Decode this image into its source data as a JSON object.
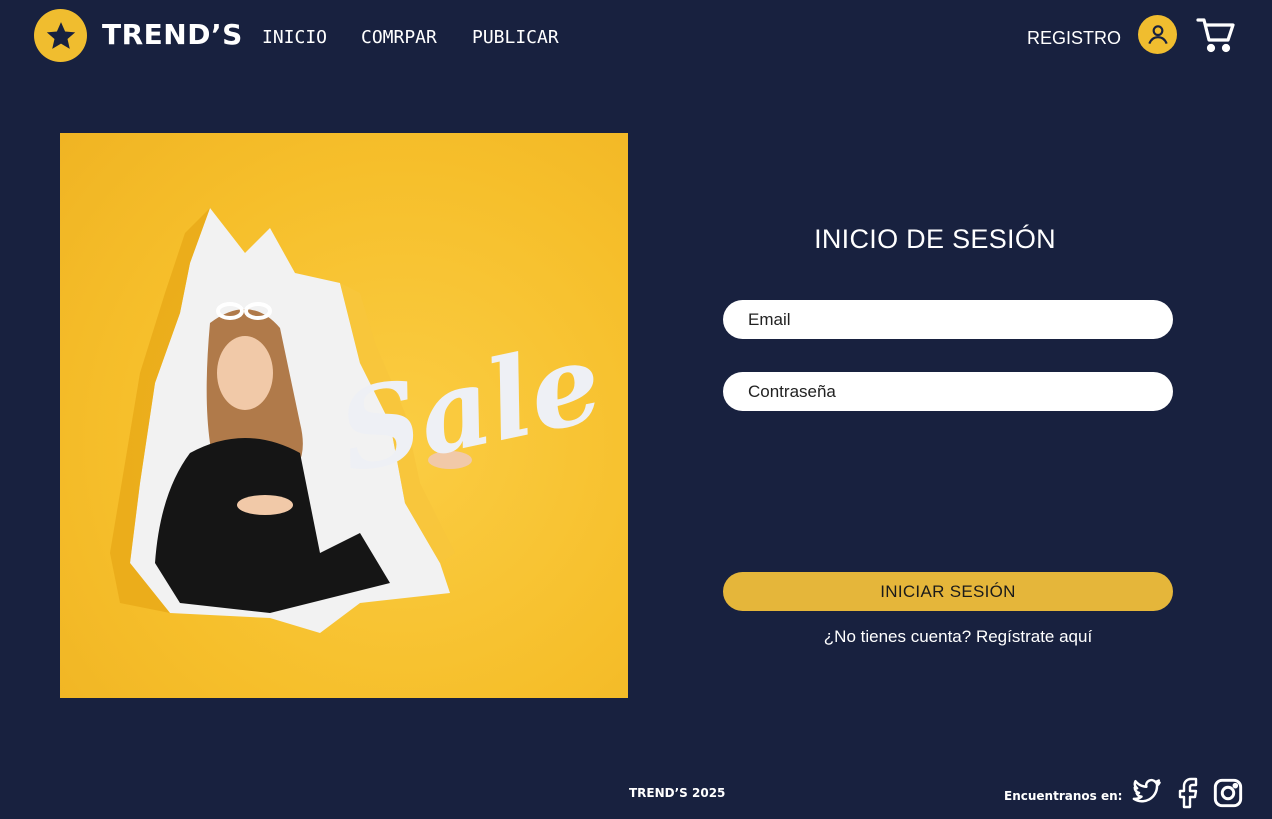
{
  "brand": {
    "name": "TREND’S",
    "accent": "#f0bd2f",
    "background": "#18213f"
  },
  "nav": {
    "links": [
      {
        "label": "INICIO"
      },
      {
        "label": "COMRPAR"
      },
      {
        "label": "PUBLICAR"
      }
    ],
    "register_label": "REGISTRO",
    "icons": [
      "star-icon",
      "user-icon",
      "cart-icon"
    ]
  },
  "hero": {
    "image_text": "Sale",
    "image_description_icon": "sale-promo-image"
  },
  "login": {
    "title": "INICIO DE SESIÓN",
    "email_placeholder": "Email",
    "password_placeholder": "Contraseña",
    "submit_label": "INICIAR SESIÓN",
    "no_account_text": "¿No tienes cuenta?",
    "signup_link": "Regístrate aquí"
  },
  "footer": {
    "copyright": "TREND’S 2025",
    "find_us": "Encuentranos en:",
    "social_icons": [
      "twitter-icon",
      "facebook-icon",
      "instagram-icon"
    ]
  }
}
